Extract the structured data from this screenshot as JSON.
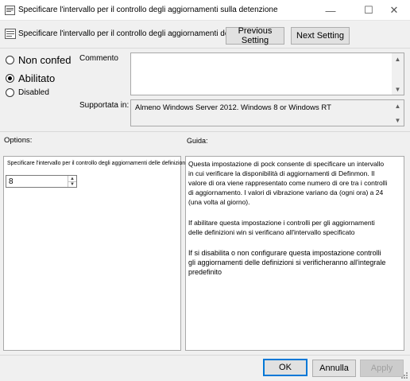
{
  "window": {
    "title": "Specificare l'intervallo per il controllo degli aggiornamenti sulla detenzione",
    "minimize_glyph": "—",
    "maximize_glyph": "☐",
    "close_glyph": "✕"
  },
  "header": {
    "policy_title": "Specificare l'intervallo per il controllo degli aggiornamenti delle definizioni",
    "previous_label": "Previous Setting",
    "next_label": "Next Setting"
  },
  "state": {
    "options": [
      {
        "label": "Non confed",
        "checked": false
      },
      {
        "label": "Abilitato",
        "checked": true
      },
      {
        "label": "Disabled",
        "checked": false
      }
    ]
  },
  "comment": {
    "label": "Commento",
    "value": ""
  },
  "supported": {
    "label": "Supportata in:",
    "value": "Almeno Windows Server 2012. Windows 8 or Windows RT"
  },
  "options_panel": {
    "heading": "Options:",
    "field_label": "Specificare l'intervallo per il controllo degli aggiornamenti delle definizioni",
    "spinner_value": "8"
  },
  "help_panel": {
    "heading": "Guida:",
    "paragraphs": [
      "Questa impostazione di pock consente di specificare un intervallo in cui verificare la disponibilità di aggiornamenti di Definmon. Il valore di ora viene rappresentato come numero di ore tra i controlli di aggiornamento. I valori di vibrazione variano da (ogni ora) a 24 (una volta al giorno).",
      "If abilitare questa impostazione i controlli per gli aggiornamenti delle definizioni win si verificano all'intervallo specificato",
      "If si disabilita o non configurare questa impostazione controlli gli aggiornamenti delle definizioni si verificheranno all'integrale predefinito"
    ]
  },
  "footer": {
    "ok_label": "OK",
    "cancel_label": "Annulla",
    "apply_label": "Apply"
  }
}
